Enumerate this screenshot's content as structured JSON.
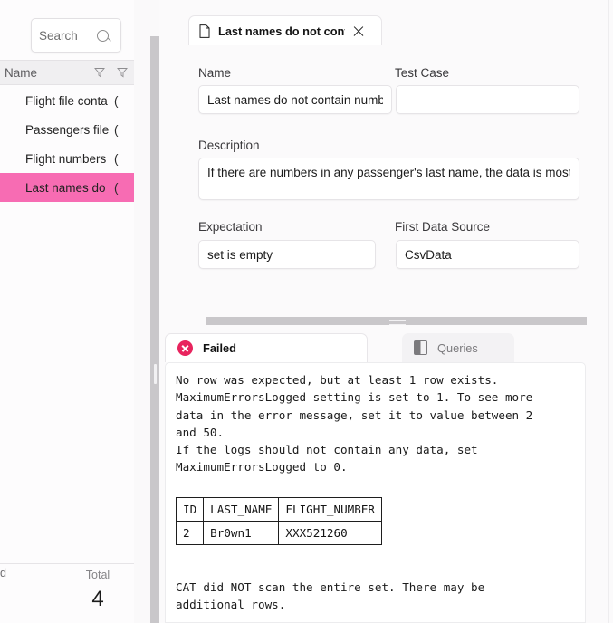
{
  "app": {
    "accent_pink": "#f76cb3",
    "fail_red": "#e8245e"
  },
  "sidebar": {
    "search": {
      "placeholder": "Search",
      "value": "",
      "icon": "search-icon"
    },
    "grid": {
      "columns": [
        {
          "label": "",
          "filter_icon": "filter-funnel-icon"
        },
        {
          "label": "Name",
          "filter_icon": "filter-funnel-icon"
        },
        {
          "label": "",
          "filter_icon": "filter-funnel-icon"
        }
      ],
      "rows": [
        {
          "name": "Flight file conta",
          "extra": "(",
          "selected": false
        },
        {
          "name": "Passengers file",
          "extra": "(",
          "selected": false
        },
        {
          "name": "Flight numbers",
          "extra": "(",
          "selected": false
        },
        {
          "name": "Last names do",
          "extra": "(",
          "selected": true
        }
      ]
    },
    "footer": {
      "clipped_label": "d",
      "total_label": "Total",
      "total_value": "4"
    }
  },
  "tabs": {
    "document_tab": {
      "icon": "document-page-icon",
      "title": "Last names do not contain num",
      "close_icon": "close-icon"
    }
  },
  "form": {
    "name": {
      "label": "Name",
      "value": "Last names do not contain numb"
    },
    "test_case": {
      "label": "Test Case",
      "value": ""
    },
    "description": {
      "label": "Description",
      "value": "If there are numbers in any passenger's last name, the data is most likely w"
    },
    "expectation": {
      "label": "Expectation",
      "value": "set is empty"
    },
    "first_data_source": {
      "label": "First Data Source",
      "value": "CsvData"
    }
  },
  "results": {
    "tabs": [
      {
        "label": "Failed",
        "icon": "error-circle-x-icon",
        "active": true
      },
      {
        "label": "Queries",
        "icon": "queries-half-square-icon",
        "active": false
      }
    ],
    "message": "No row was expected, but at least 1 row exists.\nMaximumErrorsLogged setting is set to 1. To see more\ndata in the error message, set it to value between 2\nand 50.\nIf the logs should not contain any data, set\nMaximumErrorsLogged to 0.",
    "table": {
      "headers": [
        "ID",
        "LAST_NAME",
        "FLIGHT_NUMBER"
      ],
      "rows": [
        [
          "2",
          "Br0wn1",
          "XXX521260"
        ]
      ]
    },
    "footnote": "CAT did NOT scan the entire set. There may be\nadditional rows."
  },
  "splitters": {
    "vertical": "vertical-splitter",
    "horizontal": "horizontal-splitter"
  }
}
